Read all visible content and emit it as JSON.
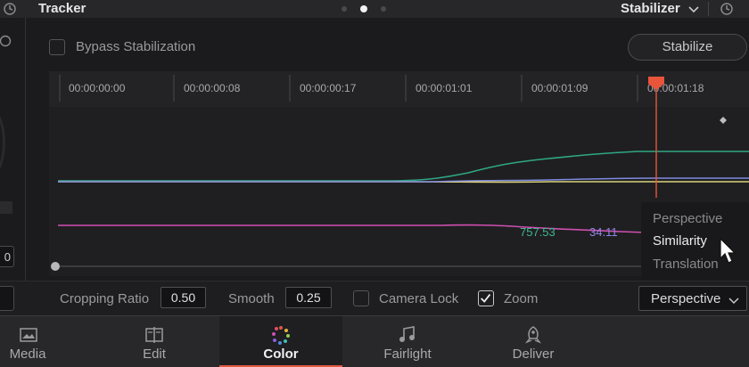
{
  "header": {
    "title": "Tracker",
    "mode": "Stabilizer",
    "pager_dots": 3,
    "pager_active": 1
  },
  "left_panel": {
    "value": "0"
  },
  "stabilize": {
    "bypass_label": "Bypass Stabilization",
    "bypass_checked": false,
    "button_label": "Stabilize"
  },
  "timeline": {
    "timecodes": [
      "00:00:00:00",
      "00:00:00:08",
      "00:00:00:17",
      "00:00:01:01",
      "00:00:01:09",
      "00:00:01:18"
    ],
    "readouts": [
      {
        "value": "757.53",
        "color": "#3fb892"
      },
      {
        "value": "34.11",
        "color": "#8c86e6"
      }
    ],
    "playhead_color": "#e8553a"
  },
  "mode_menu": {
    "options": [
      "Perspective",
      "Similarity",
      "Translation"
    ],
    "hovered": "Similarity"
  },
  "controls": {
    "cropping_ratio_label": "Cropping Ratio",
    "cropping_ratio": "0.50",
    "smooth_label": "Smooth",
    "smooth": "0.25",
    "camera_lock_label": "Camera Lock",
    "camera_lock": false,
    "zoom_label": "Zoom",
    "zoom": true,
    "type_select": "Perspective"
  },
  "nav": {
    "items": [
      {
        "label": "Media",
        "icon": "media-icon"
      },
      {
        "label": "Edit",
        "icon": "edit-icon"
      },
      {
        "label": "Color",
        "icon": "color-icon"
      },
      {
        "label": "Fairlight",
        "icon": "fairlight-icon"
      },
      {
        "label": "Deliver",
        "icon": "deliver-icon"
      }
    ],
    "active": "Color",
    "accent_color": "#e05a3f"
  },
  "colors": {
    "curve_green": "#2fa784",
    "curve_yellow": "#d9d27a",
    "curve_blue": "#7f8be0",
    "curve_magenta": "#d04fb1"
  }
}
